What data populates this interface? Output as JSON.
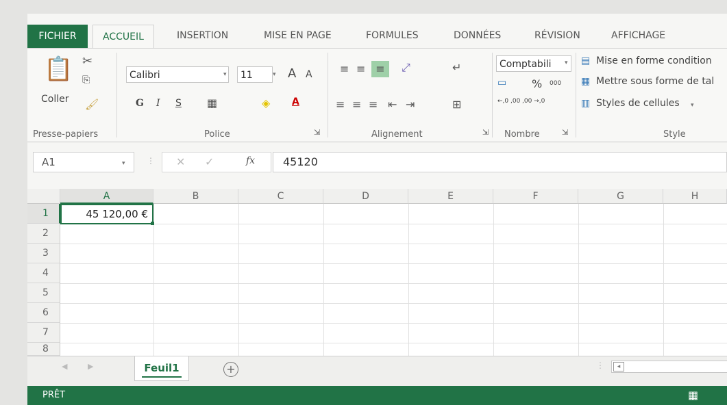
{
  "ribbon_tabs": {
    "file": "FICHIER",
    "home": "ACCUEIL",
    "insert": "INSERTION",
    "page_layout": "MISE EN PAGE",
    "formulas": "FORMULES",
    "data": "DONNÉES",
    "review": "RÉVISION",
    "view": "AFFICHAGE"
  },
  "clipboard": {
    "paste_label": "Coller",
    "group_label": "Presse-papiers"
  },
  "font": {
    "font_name": "Calibri",
    "font_size": "11",
    "bold": "G",
    "italic": "I",
    "underline": "S",
    "grow_font": "A",
    "shrink_font": "A",
    "font_color": "A",
    "group_label": "Police"
  },
  "alignment": {
    "group_label": "Alignement"
  },
  "number": {
    "format": "Comptabili",
    "percent": "%",
    "thousands": "000",
    "inc_decimal": "←,0 ,00",
    "dec_decimal": ",00 →,0",
    "group_label": "Nombre"
  },
  "styles": {
    "conditional": "Mise en forme condition",
    "table": "Mettre sous forme de tal",
    "cell_styles": "Styles de cellules",
    "group_label": "Style"
  },
  "formula_bar": {
    "name_box": "A1",
    "fx": "fx",
    "value": "45120"
  },
  "columns": [
    "A",
    "B",
    "C",
    "D",
    "E",
    "F",
    "G",
    "H"
  ],
  "rows": [
    "1",
    "2",
    "3",
    "4",
    "5",
    "6",
    "7",
    "8"
  ],
  "cells": {
    "A1": "45 120,00 €"
  },
  "sheets": {
    "tab1": "Feuil1",
    "add": "+"
  },
  "status": {
    "ready": "PRÊT"
  },
  "colors": {
    "accent": "#217346",
    "status_bar": "#217346"
  }
}
